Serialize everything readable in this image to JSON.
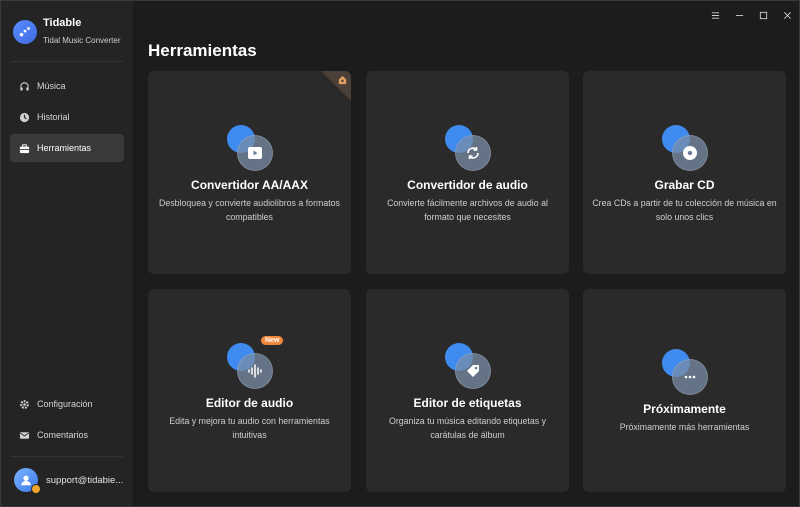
{
  "app": {
    "name": "Tidable",
    "subtitle": "Tidal Music Converter"
  },
  "sidebar": {
    "items": [
      {
        "label": "Música",
        "icon": "headphones-icon",
        "active": false
      },
      {
        "label": "Historial",
        "icon": "clock-icon",
        "active": false
      },
      {
        "label": "Herramientas",
        "icon": "toolbox-icon",
        "active": true
      }
    ],
    "bottom_items": [
      {
        "label": "Configuración",
        "icon": "gear-icon"
      },
      {
        "label": "Comentarios",
        "icon": "mail-icon"
      }
    ],
    "user": {
      "email": "support@tidabie..."
    }
  },
  "window_controls": [
    "menu-icon",
    "minimize-icon",
    "maximize-icon",
    "close-icon"
  ],
  "main": {
    "title": "Herramientas",
    "cards": [
      {
        "title": "Convertidor AA/AAX",
        "desc": "Desbloquea y convierte audiolibros a formatos compatibles",
        "icon": "play-video-icon"
      },
      {
        "title": "Convertidor de audio",
        "desc": "Convierte fácilmente archivos de audio al formato que necesites",
        "icon": "convert-icon"
      },
      {
        "title": "Grabar CD",
        "desc": "Crea CDs a partir de tu colección de música en solo unos clics",
        "icon": "cd-icon"
      },
      {
        "title": "Editor de audio",
        "desc": "Edita y mejora tu audio con herramientas intuitivas",
        "icon": "waveform-icon",
        "badge": "New"
      },
      {
        "title": "Editor de etiquetas",
        "desc": "Organiza tu música editando etiquetas y carátulas de álbum",
        "icon": "tag-icon"
      },
      {
        "title": "Próximamente",
        "desc": "Próximamente más herramientas",
        "icon": "more-icon"
      }
    ]
  },
  "colors": {
    "accent": "#3f8bf0",
    "badge": "#f0873a",
    "card": "#2a2a2a",
    "sidebar": "#242424"
  }
}
